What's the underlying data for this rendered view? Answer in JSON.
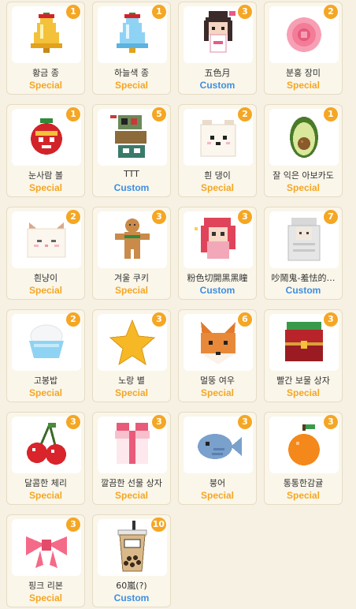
{
  "colors": {
    "special": "#f5a623",
    "custom": "#3d8fe0",
    "badge": "#f5a623"
  },
  "items": [
    {
      "name": "황금 종",
      "type": "Special",
      "count": "1",
      "icon": "golden-bell-icon"
    },
    {
      "name": "하늘색 종",
      "type": "Special",
      "count": "1",
      "icon": "skyblue-bell-icon"
    },
    {
      "name": "五色月",
      "type": "Custom",
      "count": "3",
      "icon": "girl-avatar-icon"
    },
    {
      "name": "분홍 장미",
      "type": "Special",
      "count": "2",
      "icon": "pink-rose-icon"
    },
    {
      "name": "눈사람 볼",
      "type": "Special",
      "count": "1",
      "icon": "snowman-ball-icon"
    },
    {
      "name": "TTT",
      "type": "Custom",
      "count": "5",
      "icon": "ttt-stack-icon"
    },
    {
      "name": "흰 댕이",
      "type": "Special",
      "count": "2",
      "icon": "white-puppy-icon"
    },
    {
      "name": "잘 익은 아보카도",
      "type": "Special",
      "count": "1",
      "icon": "avocado-icon"
    },
    {
      "name": "흰냥이",
      "type": "Special",
      "count": "2",
      "icon": "white-cat-icon"
    },
    {
      "name": "겨울 쿠키",
      "type": "Special",
      "count": "3",
      "icon": "gingerbread-cookie-icon"
    },
    {
      "name": "粉色切開黑黑瞳",
      "type": "Custom",
      "count": "3",
      "icon": "pink-hair-girl-icon"
    },
    {
      "name": "吵鬧鬼-羞怯的…",
      "type": "Custom",
      "count": "7",
      "icon": "ghost-girl-icon"
    },
    {
      "name": "고봉밥",
      "type": "Special",
      "count": "2",
      "icon": "rice-bowl-icon"
    },
    {
      "name": "노랑 별",
      "type": "Special",
      "count": "3",
      "icon": "yellow-star-icon"
    },
    {
      "name": "멀뚱 여우",
      "type": "Special",
      "count": "6",
      "icon": "fox-icon"
    },
    {
      "name": "빨간 보물 상자",
      "type": "Special",
      "count": "3",
      "icon": "red-treasure-chest-icon"
    },
    {
      "name": "달콤한 체리",
      "type": "Special",
      "count": "3",
      "icon": "cherry-icon"
    },
    {
      "name": "깔끔한 선물 상자",
      "type": "Special",
      "count": "3",
      "icon": "gift-box-icon"
    },
    {
      "name": "붕어",
      "type": "Special",
      "count": "3",
      "icon": "fish-bread-icon"
    },
    {
      "name": "통통한감귤",
      "type": "Special",
      "count": "3",
      "icon": "tangerine-icon"
    },
    {
      "name": "핑크 리본",
      "type": "Special",
      "count": "3",
      "icon": "pink-ribbon-icon"
    },
    {
      "name": "60嵐(?)",
      "type": "Custom",
      "count": "10",
      "icon": "bubble-tea-icon"
    }
  ]
}
